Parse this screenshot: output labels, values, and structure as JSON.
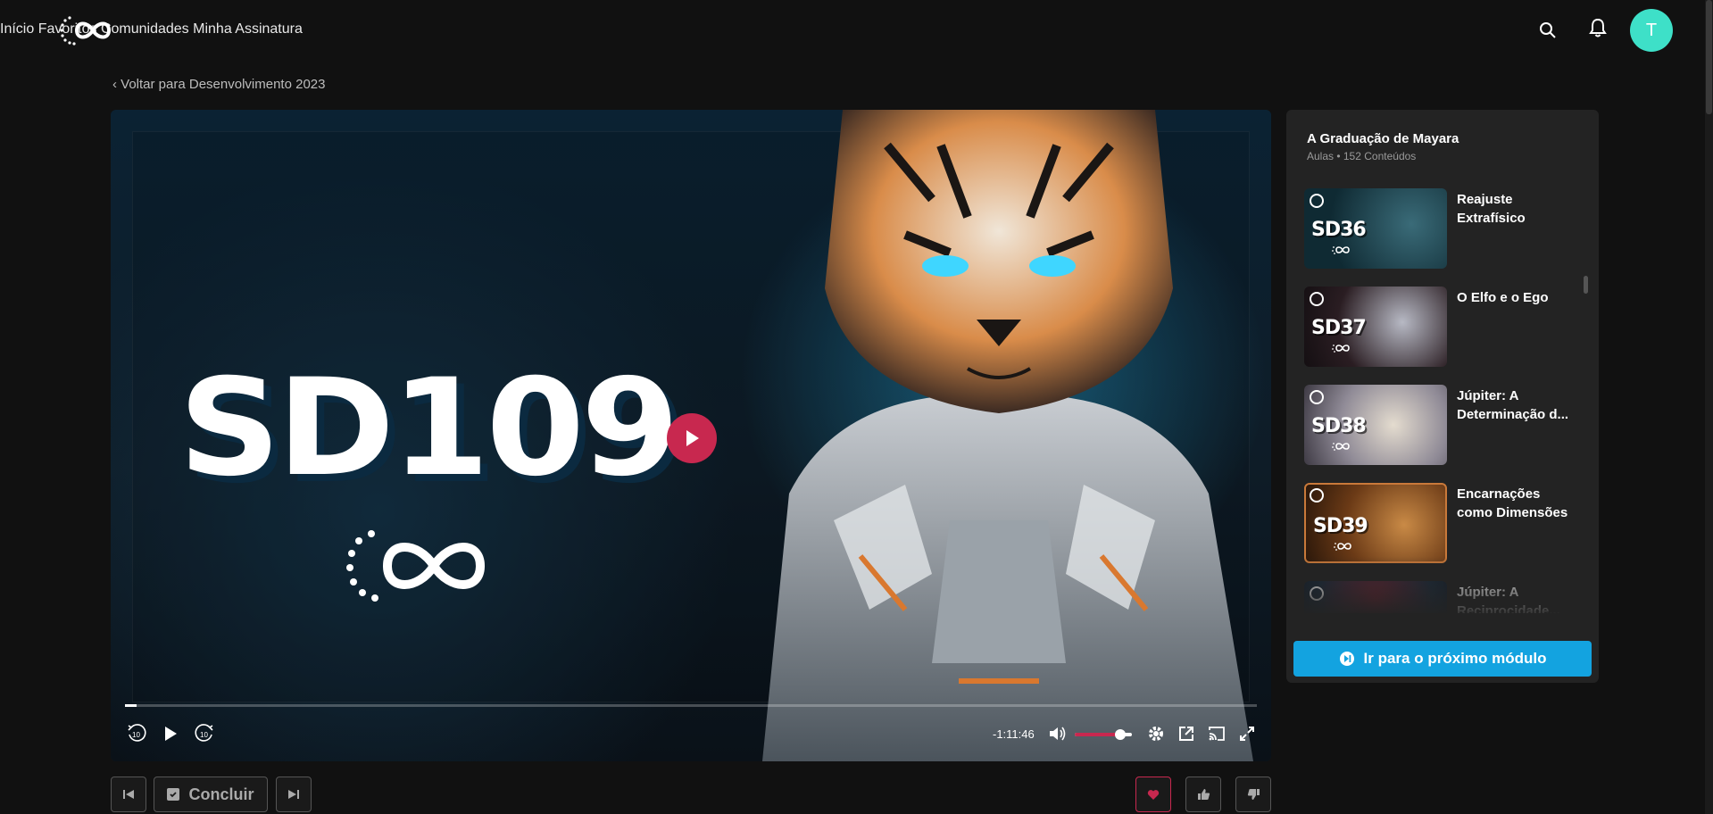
{
  "header": {
    "nav": [
      "Início",
      "Favoritos",
      "Comunidades",
      "Minha Assinatura"
    ],
    "avatar_letter": "T"
  },
  "back_link": "‹ Voltar para Desenvolvimento 2023",
  "player": {
    "poster_title": "SD109",
    "time_remaining": "-1:11:46",
    "progress": 0.01,
    "volume": 0.8,
    "accent": "#c8284f"
  },
  "actions": {
    "concluir": "Concluir"
  },
  "sidebar": {
    "title": "A Graduação de Mayara",
    "subtitle": "Aulas • 152 Conteúdos",
    "items": [
      {
        "thumb_label": "SD36",
        "title": "Reajuste Extrafísico"
      },
      {
        "thumb_label": "SD37",
        "title": "O Elfo e o Ego"
      },
      {
        "thumb_label": "SD38",
        "title": "Júpiter: A Determinação d..."
      },
      {
        "thumb_label": "SD39",
        "title": "Encarnações como Dimensões"
      },
      {
        "thumb_label": "",
        "title": "Júpiter: A Reciprocidade..."
      }
    ],
    "next_module": "Ir para o próximo módulo",
    "accent": "#13a3e0"
  }
}
